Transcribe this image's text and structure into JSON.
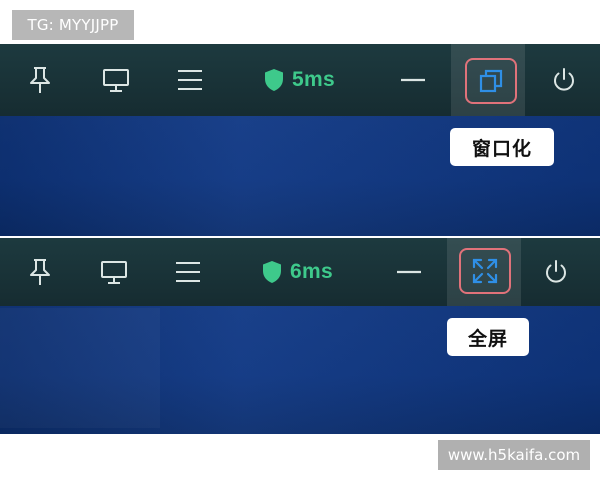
{
  "watermark_top": "TG: MYYJJPP",
  "watermark_bottom": "www.h5kaifa.com",
  "colors": {
    "toolbar_bg": "#1a3338",
    "icon": "#dce6e4",
    "latency_green": "#3ec98b",
    "highlight_border": "#e0727a",
    "fullscreen_icon_blue": "#2f8fe6",
    "desktop_blue": "#123a86"
  },
  "toolbars": [
    {
      "icons": [
        "pin-icon",
        "monitor-icon",
        "menu-icon",
        "shield-icon",
        "minimize-icon",
        "window-mode-icon",
        "power-icon"
      ],
      "latency": "5ms",
      "highlighted_button": "window-mode-button",
      "tooltip": "窗口化"
    },
    {
      "icons": [
        "pin-icon",
        "monitor-icon",
        "menu-icon",
        "shield-icon",
        "minimize-icon",
        "fullscreen-icon",
        "power-icon"
      ],
      "latency": "6ms",
      "highlighted_button": "fullscreen-button",
      "tooltip": "全屏"
    }
  ]
}
